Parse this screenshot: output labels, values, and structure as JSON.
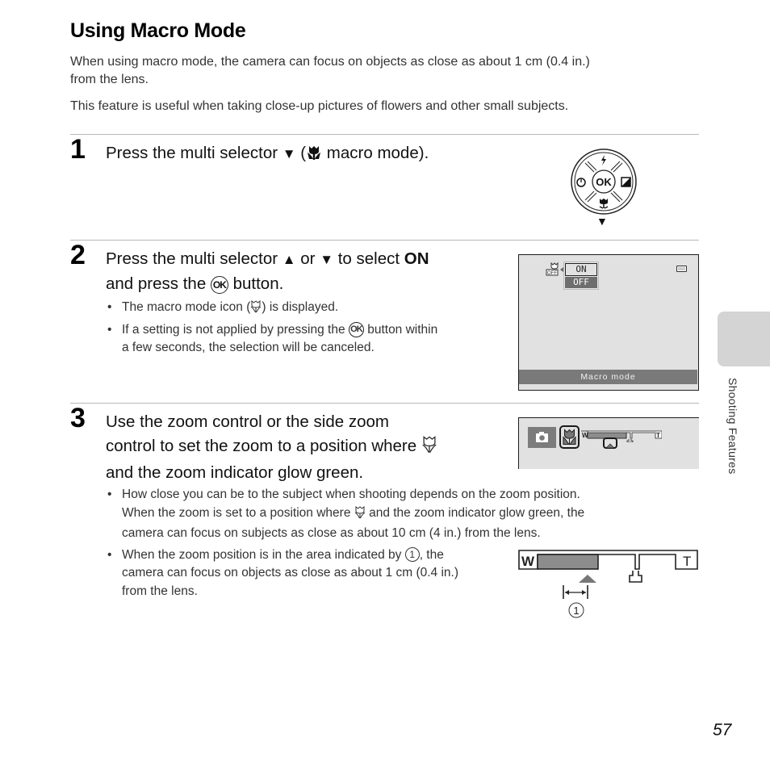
{
  "page": {
    "title": "Using Macro Mode",
    "intro_line1": "When using macro mode, the camera can focus on objects as close as about 1 cm (0.4 in.)",
    "intro_line2": "from the lens.",
    "intro_para2": "This feature is useful when taking close-up pictures of flowers and other small subjects.",
    "page_number": "57",
    "side_tab_label": "Shooting Features"
  },
  "steps": [
    {
      "number": "1",
      "heading_pre": "Press the multi selector ",
      "heading_arrow": "▼",
      "heading_paren_open": " (",
      "heading_post": " macro mode).",
      "figure": {
        "center_label": "OK",
        "down_arrow": "▼",
        "icons": [
          "flash-icon",
          "self-timer-icon",
          "exposure-compensation-icon",
          "macro-icon"
        ]
      }
    },
    {
      "number": "2",
      "heading_line1_pre": "Press the multi selector ",
      "heading_up": "▲",
      "heading_or": " or ",
      "heading_down": "▼",
      "heading_to_select": " to select ",
      "heading_on": "ON",
      "heading_line2_pre": "and press the ",
      "heading_ok": "OK",
      "heading_line2_post": " button.",
      "bullets": [
        {
          "pre": "The macro mode icon (",
          "post": ") is displayed."
        },
        {
          "pre": "If a setting is not applied by pressing the ",
          "ok": "OK",
          "post": " button within",
          "line2": "a few seconds, the selection will be canceled."
        }
      ],
      "screen": {
        "menu_options": [
          "ON",
          "OFF"
        ],
        "selected_option": "ON",
        "highlighted_option": "OFF",
        "footer_label": "Macro mode"
      }
    },
    {
      "number": "3",
      "heading_line1": "Use the zoom control or the side zoom",
      "heading_line2": "control to set the zoom to a position where ",
      "heading_line3": "and the zoom indicator glow green.",
      "screen": {
        "wide_label": "W",
        "tele_label": "T"
      },
      "bullets": [
        {
          "line1": "How close you can be to the subject when shooting depends on the zoom position.",
          "line2_pre": "When the zoom is set to a position where ",
          "line2_post": " and the zoom indicator glow green, the",
          "line3": "camera can focus on subjects as close as about 10 cm (4 in.) from the lens."
        },
        {
          "line1_pre": "When the zoom position is in the area indicated by ",
          "callout": "1",
          "line1_post": ", the",
          "line2": "camera can focus on objects as close as about 1 cm (0.4 in.)",
          "line3": "from the lens."
        }
      ],
      "zoom_diagram": {
        "wide_label": "W",
        "tele_label": "T",
        "callout": "1",
        "macro_range_fraction": 0.38
      }
    }
  ],
  "colors": {
    "screen_bg": "#e1e1e1",
    "screen_bar": "#7a7a7a",
    "fill_gray": "#8c8c8c",
    "rule": "#b8b8b8",
    "side_tab": "#d4d4d4"
  }
}
